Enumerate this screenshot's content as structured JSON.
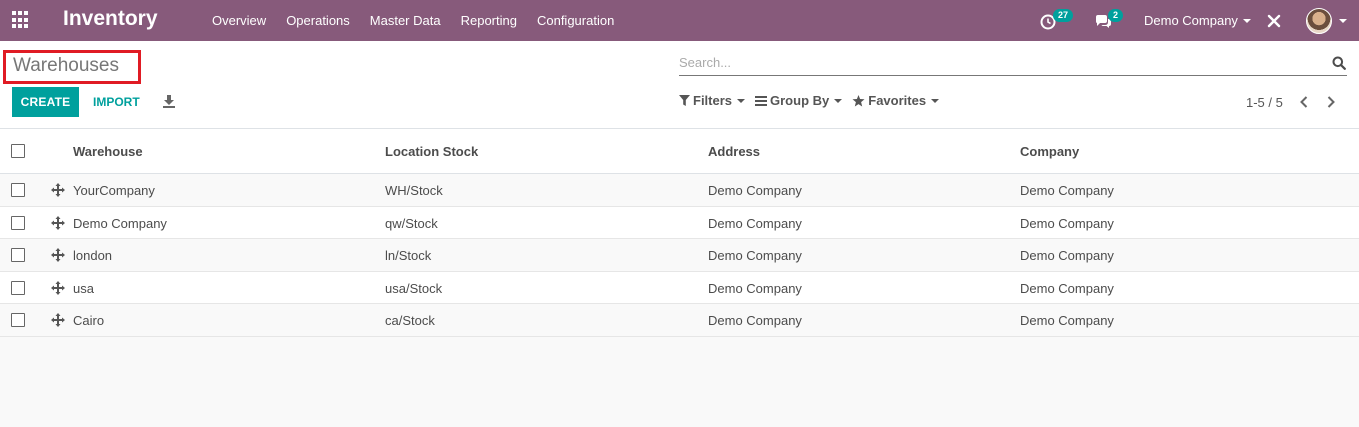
{
  "navbar": {
    "brand": "Inventory",
    "menu": [
      "Overview",
      "Operations",
      "Master Data",
      "Reporting",
      "Configuration"
    ],
    "activities_count": "27",
    "messages_count": "2",
    "company": "Demo Company",
    "accent": "#875a7b"
  },
  "control_panel": {
    "title": "Warehouses",
    "search_placeholder": "Search...",
    "create_label": "CREATE",
    "import_label": "IMPORT",
    "filters_label": "Filters",
    "groupby_label": "Group By",
    "favorites_label": "Favorites",
    "pager": "1-5 / 5",
    "button_color": "#00a09d"
  },
  "table": {
    "headers": [
      "Warehouse",
      "Location Stock",
      "Address",
      "Company"
    ],
    "rows": [
      {
        "warehouse": "YourCompany",
        "location": "WH/Stock",
        "address": "Demo Company",
        "company": "Demo Company"
      },
      {
        "warehouse": "Demo Company",
        "location": "qw/Stock",
        "address": "Demo Company",
        "company": "Demo Company"
      },
      {
        "warehouse": "london",
        "location": "ln/Stock",
        "address": "Demo Company",
        "company": "Demo Company"
      },
      {
        "warehouse": "usa",
        "location": "usa/Stock",
        "address": "Demo Company",
        "company": "Demo Company"
      },
      {
        "warehouse": "Cairo",
        "location": "ca/Stock",
        "address": "Demo Company",
        "company": "Demo Company"
      }
    ]
  },
  "icons": {
    "apps": "apps-grid-icon",
    "activity": "clock-icon",
    "messages": "chat-icon",
    "debug": "tools-icon",
    "search": "search-icon",
    "download": "download-icon",
    "drag": "drag-handle-icon"
  }
}
